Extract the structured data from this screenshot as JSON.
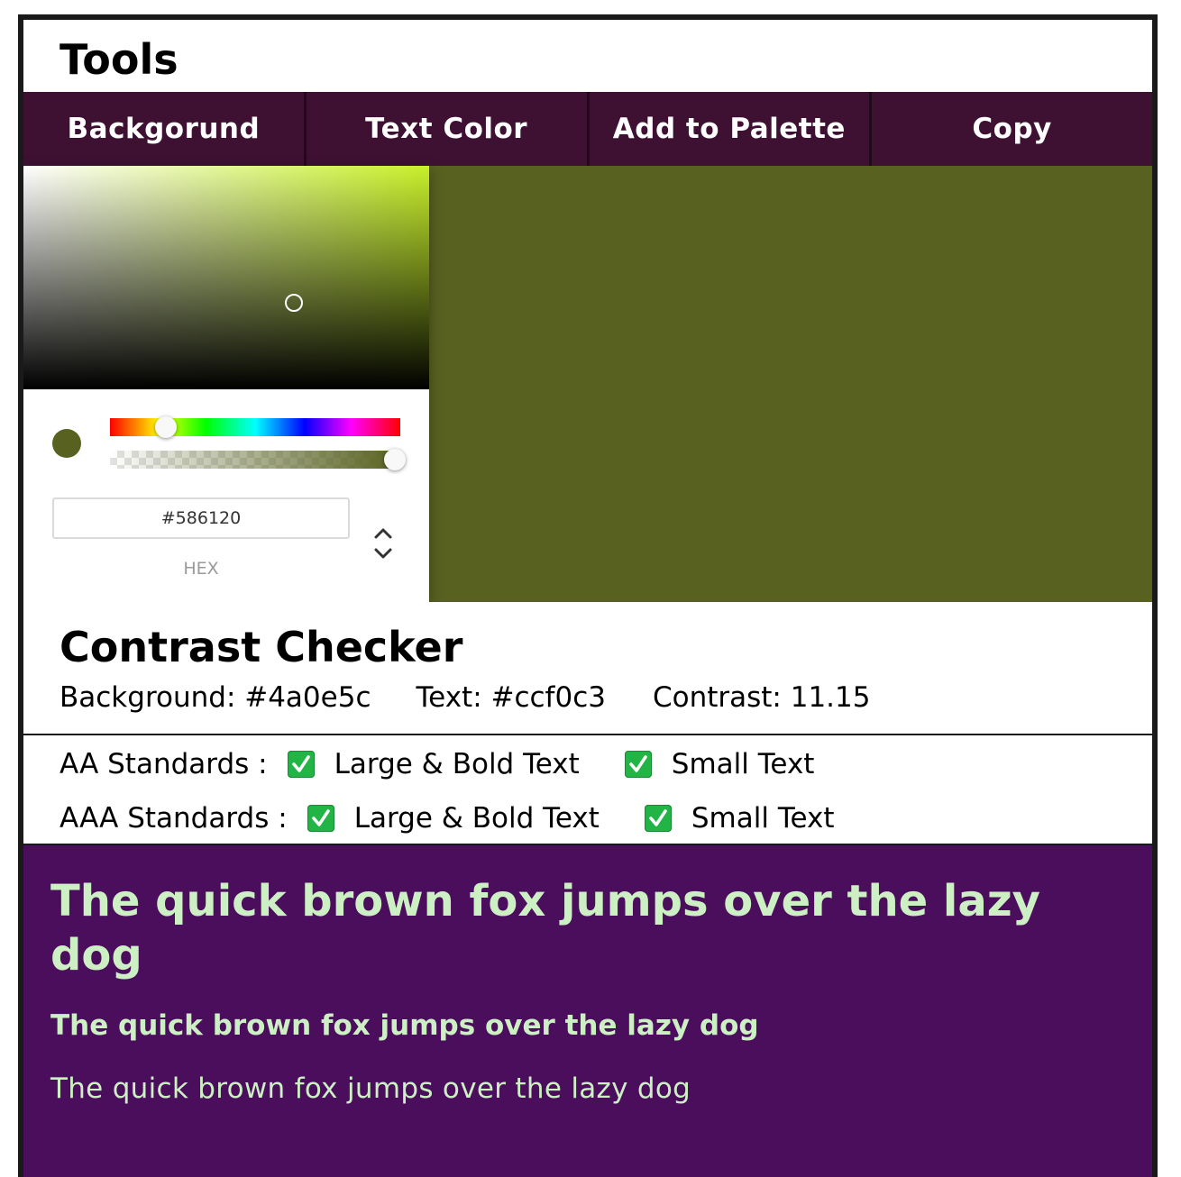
{
  "header": {
    "title": "Tools"
  },
  "toolbar": {
    "buttons": [
      {
        "label": "Backgorund"
      },
      {
        "label": "Text Color"
      },
      {
        "label": "Add to Palette"
      },
      {
        "label": "Copy"
      }
    ]
  },
  "colors": {
    "toolbar_bg": "#3e1133",
    "selected_color": "#586120",
    "saturation_hue": "#c8f02a",
    "preview_bg": "#4a0e5c",
    "preview_text": "#ccf0c3",
    "check_green": "#22b545"
  },
  "picker": {
    "hex_value": "#586120",
    "format_label": "HEX",
    "hue_level": 0.2,
    "alpha_level": 1.0,
    "toggle_icon": "up-down-chevrons-icon"
  },
  "checker": {
    "title": "Contrast Checker",
    "background_label": "Background: #4a0e5c",
    "text_label": "Text: #ccf0c3",
    "contrast_label": "Contrast: 11.15"
  },
  "standards": {
    "aa_label": "AA Standards :",
    "aaa_label": "AAA Standards :",
    "large_label": "Large & Bold Text",
    "small_label": "Small Text",
    "check_icon": "checkmark-icon"
  },
  "preview": {
    "large_text": "The quick brown fox jumps over the lazy dog",
    "bold_text": "The quick brown fox jumps over the lazy dog",
    "small_text": "The quick brown fox jumps over the lazy dog"
  }
}
